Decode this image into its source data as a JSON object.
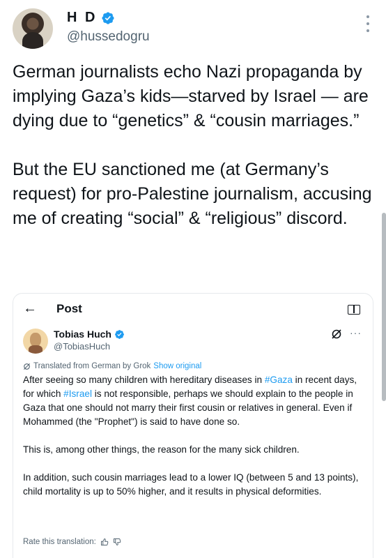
{
  "author": {
    "name": "H D",
    "handle": "@hussedogru"
  },
  "tweet": {
    "paragraph1": "German journalists echo Nazi propaganda by implying Gaza’s kids—starved by Israel — are dying due to “genetics” & “cousin marriages.”",
    "paragraph2": "But the EU sanctioned me (at Germany’s request) for pro-Palestine journalism, accusing me of creating “social” & “religious” discord."
  },
  "quoted_post": {
    "header_title": "Post",
    "back_icon": "←",
    "author_name": "Tobias Huch",
    "author_handle": "@TobiasHuch",
    "more_label": "···",
    "translated_label": "Translated from German by Grok",
    "show_original_label": "Show original",
    "p1_a": "After seeing so many children with hereditary diseases in ",
    "p1_tag1": "#Gaza",
    "p1_b": " in recent days, for which ",
    "p1_tag2": "#Israel",
    "p1_c": " is not responsible, perhaps we should explain to the people in Gaza that one should not marry their first cousin or relatives in general. Even if Mohammed (the \"Prophet\") is said to have done so.",
    "p2": "This is, among other things, the reason for the many sick children.",
    "p3": "In addition, such cousin marriages lead to a lower IQ (between 5 and 13 points), child mortality is up to 50% higher, and it results in physical deformities.",
    "rate_label": "Rate this translation:"
  },
  "colors": {
    "accent": "#1d9bf0",
    "secondary_text": "#536471",
    "primary_text": "#0f1419"
  }
}
